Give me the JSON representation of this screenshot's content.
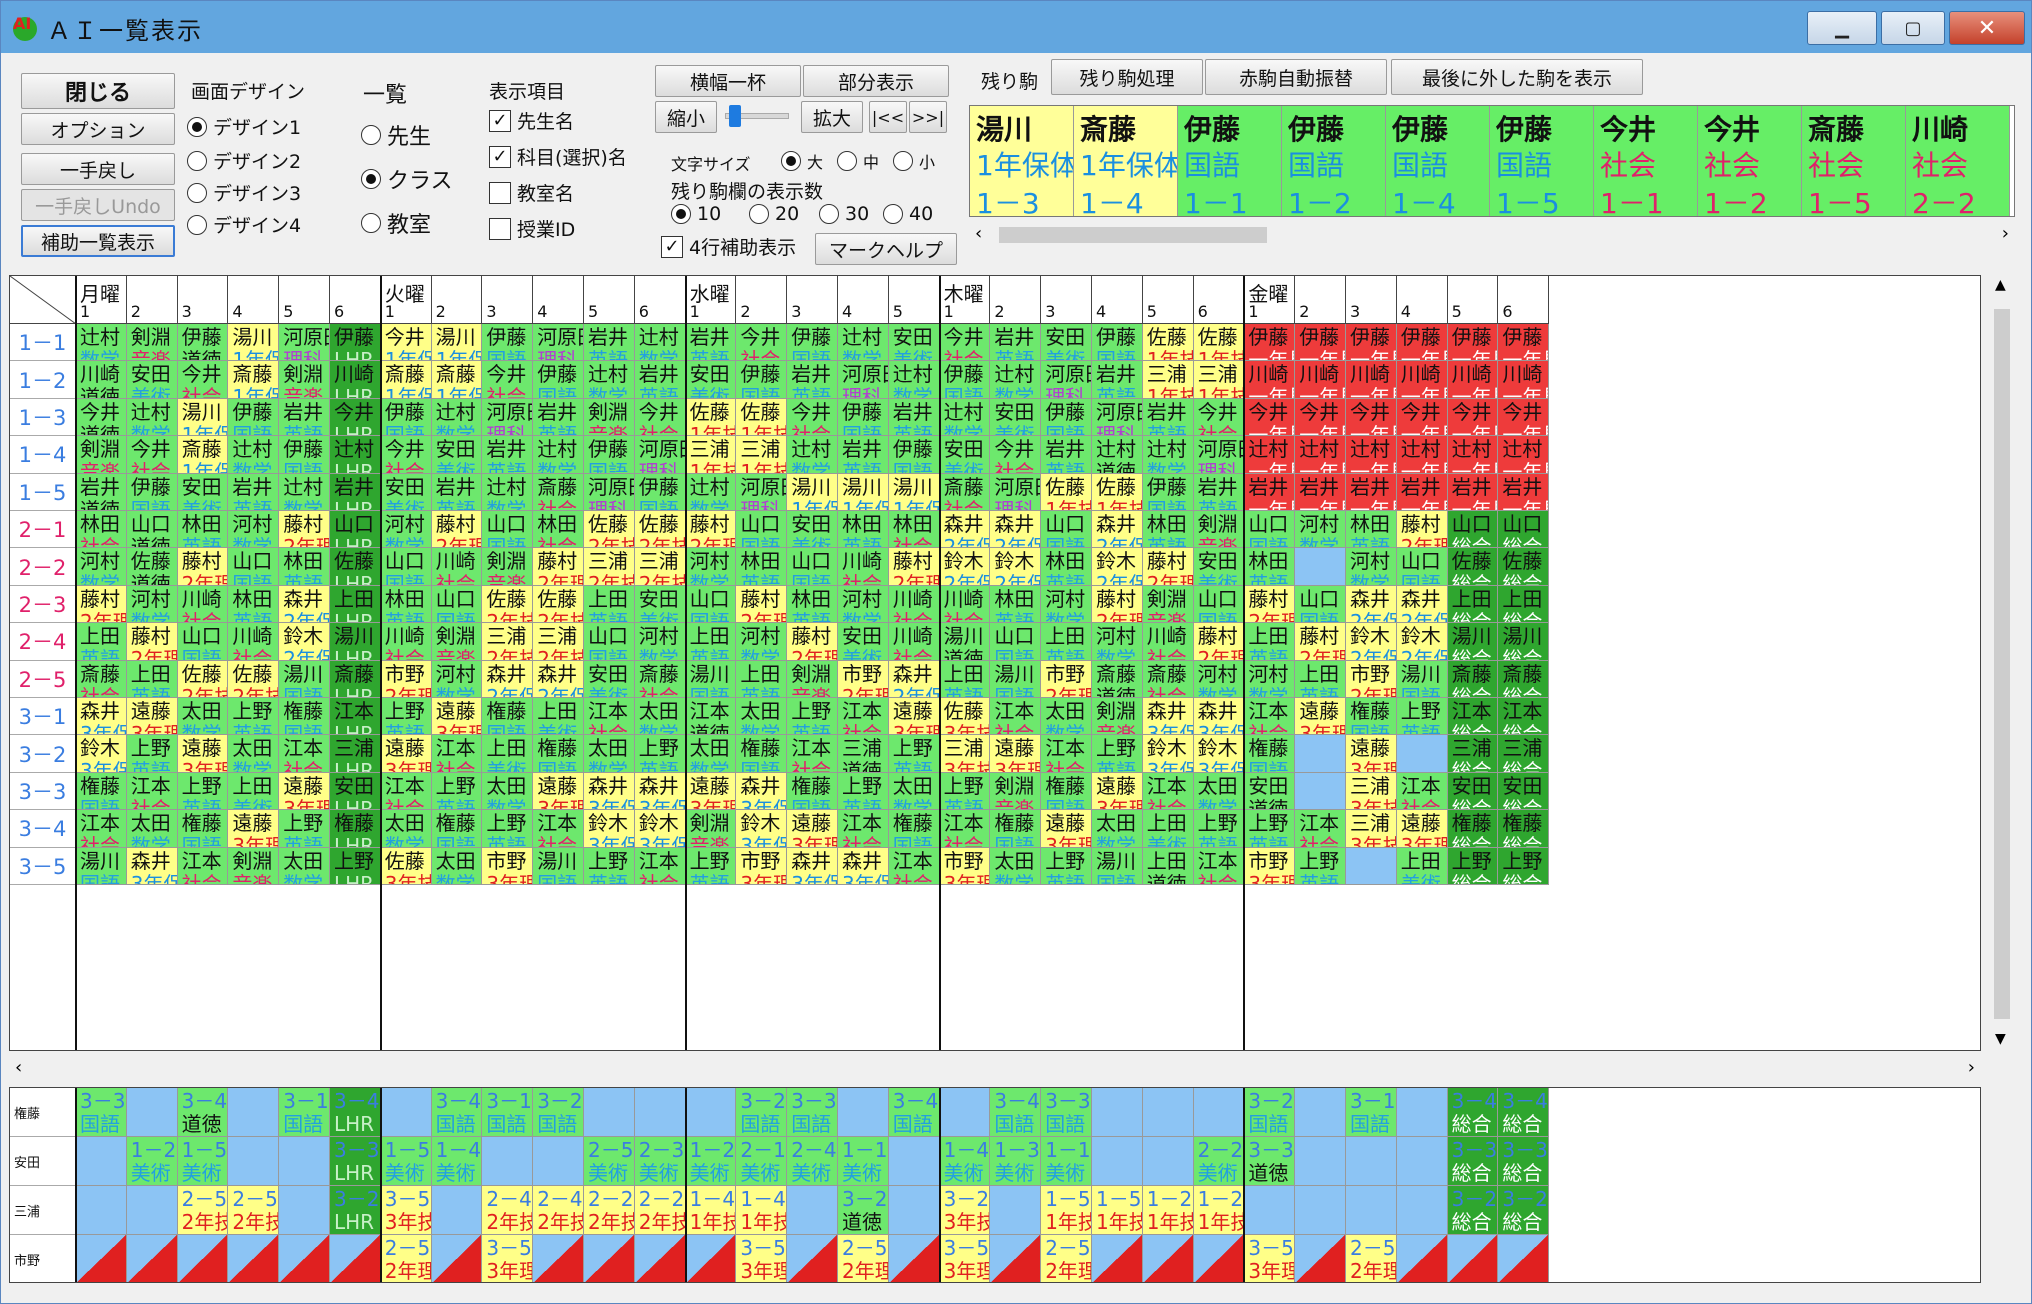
{
  "window": {
    "title": "ＡＩ一覧表示"
  },
  "controls": {
    "close": "閉じる",
    "option": "オプション",
    "undo": "一手戻し",
    "redo": "一手戻しUndo",
    "aux": "補助一覧表示",
    "design_title": "画面デザイン",
    "design_options": [
      "デザイン1",
      "デザイン2",
      "デザイン3",
      "デザイン4"
    ],
    "list_title": "一覧",
    "list_options": [
      "先生",
      "クラス",
      "教室"
    ],
    "items_title": "表示項目",
    "items": [
      "先生名",
      "科目(選択)名",
      "教室名",
      "授業ID"
    ],
    "full_width": "横幅一杯",
    "partial": "部分表示",
    "shrink": "縮小",
    "expand": "拡大",
    "nav_prev": "|<<",
    "nav_next": ">>|",
    "font_size_label": "文字サイズ",
    "font_sizes": [
      "大",
      "中",
      "小"
    ],
    "remain_count_label": "残り駒欄の表示数",
    "remain_counts": [
      "10",
      "20",
      "30",
      "40"
    ],
    "four_row": "4行補助表示",
    "mark_help": "マークヘルプ",
    "remain_label": "残り駒",
    "remain_process": "残り駒処理",
    "red_auto": "赤駒自動振替",
    "last_removed": "最後に外した駒を表示"
  },
  "remain_pieces": [
    {
      "t": "湯川",
      "s": "1年保体2",
      "c": "1－3",
      "bg": "#ffff99",
      "sc": "#1a8fe0"
    },
    {
      "t": "斎藤",
      "s": "1年保体2",
      "c": "1－4",
      "bg": "#ffff99",
      "sc": "#1a8fe0"
    },
    {
      "t": "伊藤",
      "s": "国語",
      "c": "1－1",
      "bg": "#66ee66",
      "sc": "#1a8fe0"
    },
    {
      "t": "伊藤",
      "s": "国語",
      "c": "1－2",
      "bg": "#66ee66",
      "sc": "#1a8fe0"
    },
    {
      "t": "伊藤",
      "s": "国語",
      "c": "1－4",
      "bg": "#66ee66",
      "sc": "#1a8fe0"
    },
    {
      "t": "伊藤",
      "s": "国語",
      "c": "1－5",
      "bg": "#66ee66",
      "sc": "#1a8fe0"
    },
    {
      "t": "今井",
      "s": "社会",
      "c": "1－1",
      "bg": "#66ee66",
      "sc": "#e0206a"
    },
    {
      "t": "今井",
      "s": "社会",
      "c": "1－2",
      "bg": "#66ee66",
      "sc": "#e0206a"
    },
    {
      "t": "斎藤",
      "s": "社会",
      "c": "1－5",
      "bg": "#66ee66",
      "sc": "#e0206a"
    },
    {
      "t": "川崎",
      "s": "社会",
      "c": "2－2",
      "bg": "#66ee66",
      "sc": "#e0206a"
    }
  ],
  "days": [
    "月曜",
    "火曜",
    "水曜",
    "木曜",
    "金曜"
  ],
  "periods": [
    6,
    6,
    5,
    6,
    6
  ],
  "classes": [
    "1－1",
    "1－2",
    "1－3",
    "1－4",
    "1－5",
    "2－1",
    "2－2",
    "2－3",
    "2－4",
    "2－5",
    "3－1",
    "3－2",
    "3－3",
    "3－4",
    "3－5"
  ],
  "schedule": [
    [
      "辻村 数学",
      "剣淵 音楽",
      "伊藤 道徳",
      "湯川 1年保",
      "河原田 理科",
      "伊藤 LHR",
      "今井 1年保",
      "湯川 1年保",
      "伊藤 国語",
      "河原田 理科",
      "岩井 英語",
      "辻村 数学",
      "岩井 英語",
      "今井 社会",
      "伊藤 国語",
      "辻村 数学",
      "安田 美術",
      "今井 社会",
      "岩井 英語",
      "安田 美術",
      "伊藤 国語",
      "佐藤 1年技",
      "佐藤 1年技",
      "伊藤 一年見",
      "伊藤 一年見",
      "伊藤 一年見",
      "伊藤 一年見",
      "伊藤 一年見",
      "伊藤 一年見"
    ],
    [
      "川崎 道徳",
      "安田 美術",
      "今井 社会",
      "斎藤 1年保",
      "剣淵 音楽",
      "川崎 LHR",
      "斎藤 1年保",
      "斎藤 1年保",
      "今井 社会",
      "伊藤 国語",
      "辻村 数学",
      "岩井 英語",
      "安田 美術",
      "伊藤 国語",
      "岩井 英語",
      "河原田 理科",
      "辻村 数学",
      "伊藤 国語",
      "辻村 数学",
      "河原田 理科",
      "岩井 英語",
      "三浦 1年技",
      "三浦 1年技",
      "川崎 一年見",
      "川崎 一年見",
      "川崎 一年見",
      "川崎 一年見",
      "川崎 一年見",
      "川崎 一年見"
    ],
    [
      "今井 道徳",
      "辻村 数学",
      "湯川 1年保",
      "伊藤 国語",
      "岩井 英語",
      "今井 LHR",
      "伊藤 国語",
      "辻村 数学",
      "河原田 理科",
      "岩井 英語",
      "剣淵 音楽",
      "今井 社会",
      "佐藤 1年技",
      "佐藤 1年技",
      "今井 社会",
      "伊藤 国語",
      "岩井 英語",
      "辻村 数学",
      "安田 美術",
      "伊藤 国語",
      "河原田 理科",
      "岩井 英語",
      "今井 社会",
      "今井 一年見",
      "今井 一年見",
      "今井 一年見",
      "今井 一年見",
      "今井 一年見",
      "今井 一年見"
    ],
    [
      "剣淵 音楽",
      "今井 社会",
      "斎藤 1年保",
      "辻村 数学",
      "伊藤 国語",
      "辻村 LHR",
      "今井 社会",
      "安田 美術",
      "岩井 英語",
      "辻村 数学",
      "伊藤 国語",
      "河原田 理科",
      "三浦 1年技",
      "三浦 1年技",
      "辻村 数学",
      "岩井 英語",
      "伊藤 国語",
      "安田 美術",
      "今井 社会",
      "岩井 英語",
      "辻村 道徳",
      "辻村 数学",
      "河原田 理科",
      "辻村 一年見",
      "辻村 一年見",
      "辻村 一年見",
      "辻村 一年見",
      "辻村 一年見",
      "辻村 一年見"
    ],
    [
      "岩井 道徳",
      "伊藤 国語",
      "安田 美術",
      "岩井 英語",
      "辻村 数学",
      "岩井 LHR",
      "安田 美術",
      "岩井 英語",
      "辻村 数学",
      "斎藤 社会",
      "河原田 理科",
      "伊藤 国語",
      "辻村 数学",
      "河原田 理科",
      "湯川 1年保",
      "湯川 1年保",
      "湯川 1年保",
      "斎藤 社会",
      "河原田 理科",
      "佐藤 1年技",
      "佐藤 1年技",
      "伊藤 国語",
      "岩井 英語",
      "岩井 一年見",
      "岩井 一年見",
      "岩井 一年見",
      "岩井 一年見",
      "岩井 一年見",
      "岩井 一年見"
    ],
    [
      "林田 社会",
      "山口 道徳",
      "林田 英語",
      "河村 数学",
      "藤村 2年理",
      "山口 LHR",
      "河村 数学",
      "藤村 2年理",
      "山口 国語",
      "林田 社会",
      "佐藤 2年技",
      "佐藤 2年技",
      "藤村 2年理",
      "山口 国語",
      "安田 美術",
      "林田 英語",
      "林田 社会",
      "森井 2年保",
      "森井 2年保",
      "山口 国語",
      "森井 2年保",
      "林田 英語",
      "剣淵 音楽",
      "山口 国語",
      "河村 数学",
      "林田 英語",
      "藤村 2年理",
      "山口 総合",
      "山口 総合"
    ],
    [
      "河村 数学",
      "佐藤 道徳",
      "藤村 2年理",
      "山口 国語",
      "林田 英語",
      "佐藤 LHR",
      "山口 国語",
      "川崎 社会",
      "剣淵 音楽",
      "藤村 2年理",
      "三浦 2年技",
      "三浦 2年技",
      "河村 数学",
      "林田 英語",
      "山口 国語",
      "川崎 社会",
      "藤村 2年理",
      "鈴木 2年保",
      "鈴木 2年保",
      "林田 英語",
      "鈴木 2年保",
      "藤村 2年理",
      "安田 美術",
      "林田 英語",
      "",
      "河村 数学",
      "山口 国語",
      "佐藤 総合",
      "佐藤 総合"
    ],
    [
      "藤村 2年理",
      "河村 数学",
      "川崎 社会",
      "林田 英語",
      "森井 2年保",
      "上田 LHR",
      "林田 英語",
      "山口 国語",
      "佐藤 2年技",
      "佐藤 2年技",
      "上田 英語",
      "安田 美術",
      "山口 国語",
      "藤村 2年理",
      "林田 英語",
      "河村 数学",
      "川崎 社会",
      "川崎 社会",
      "林田 英語",
      "河村 数学",
      "藤村 2年理",
      "剣淵 音楽",
      "山口 国語",
      "藤村 2年理",
      "山口 国語",
      "森井 2年保",
      "森井 2年保",
      "上田 総合",
      "上田 総合"
    ],
    [
      "上田 英語",
      "藤村 2年理",
      "山口 国語",
      "川崎 社会",
      "鈴木 2年保",
      "湯川 LHR",
      "川崎 社会",
      "剣淵 音楽",
      "三浦 2年技",
      "三浦 2年技",
      "山口 国語",
      "河村 数学",
      "上田 英語",
      "河村 数学",
      "藤村 2年理",
      "安田 美術",
      "川崎 社会",
      "湯川 道徳",
      "山口 国語",
      "上田 英語",
      "河村 数学",
      "川崎 社会",
      "藤村 2年理",
      "上田 英語",
      "藤村 2年理",
      "鈴木 2年保",
      "鈴木 2年保",
      "湯川 総合",
      "湯川 総合"
    ],
    [
      "斎藤 社会",
      "上田 英語",
      "佐藤 2年技",
      "佐藤 2年技",
      "湯川 国語",
      "斎藤 LHR",
      "市野 2年理",
      "河村 数学",
      "森井 2年保",
      "森井 2年保",
      "安田 美術",
      "斎藤 社会",
      "湯川 国語",
      "上田 英語",
      "剣淵 音楽",
      "市野 2年理",
      "森井 2年保",
      "上田 英語",
      "湯川 国語",
      "市野 2年理",
      "斎藤 道徳",
      "斎藤 社会",
      "河村 数学",
      "河村 数学",
      "上田 英語",
      "市野 2年理",
      "湯川 国語",
      "斎藤 総合",
      "斎藤 総合"
    ],
    [
      "森井 3年保",
      "遠藤 3年理",
      "太田 数学",
      "上野 英語",
      "権藤 国語",
      "江本 LHR",
      "上野 英語",
      "遠藤 3年理",
      "権藤 国語",
      "上田 美術",
      "江本 社会",
      "太田 数学",
      "江本 道徳",
      "太田 数学",
      "上野 英語",
      "江本 社会",
      "遠藤 3年理",
      "佐藤 3年技",
      "江本 社会",
      "太田 数学",
      "剣淵 音楽",
      "森井 3年保",
      "森井 3年保",
      "江本 社会",
      "遠藤 3年理",
      "権藤 国語",
      "上野 英語",
      "江本 総合",
      "江本 総合"
    ],
    [
      "鈴木 3年保",
      "上野 英語",
      "遠藤 3年理",
      "太田 数学",
      "江本 社会",
      "三浦 LHR",
      "遠藤 3年理",
      "江本 社会",
      "上田 美術",
      "権藤 国語",
      "太田 数学",
      "上野 英語",
      "太田 数学",
      "権藤 国語",
      "江本 社会",
      "三浦 道徳",
      "上野 英語",
      "三浦 3年技",
      "遠藤 3年理",
      "江本 社会",
      "上野 英語",
      "鈴木 3年保",
      "鈴木 3年保",
      "権藤 国語",
      "",
      "遠藤 3年理",
      "",
      "三浦 総合",
      "三浦 総合"
    ],
    [
      "権藤 国語",
      "江本 社会",
      "上野 英語",
      "上田 美術",
      "遠藤 3年理",
      "安田 LHR",
      "江本 社会",
      "上野 英語",
      "太田 数学",
      "遠藤 3年理",
      "森井 3年保",
      "森井 3年保",
      "遠藤 3年理",
      "森井 3年保",
      "権藤 国語",
      "上野 英語",
      "太田 数学",
      "上野 英語",
      "剣淵 音楽",
      "権藤 国語",
      "遠藤 3年理",
      "江本 社会",
      "太田 数学",
      "安田 道徳",
      "",
      "三浦 3年技",
      "江本 社会",
      "安田 総合",
      "安田 総合"
    ],
    [
      "江本 社会",
      "太田 数学",
      "権藤 国語",
      "遠藤 3年理",
      "上野 英語",
      "権藤 LHR",
      "太田 数学",
      "権藤 国語",
      "上野 英語",
      "江本 社会",
      "鈴木 3年保",
      "鈴木 3年保",
      "剣淵 音楽",
      "鈴木 3年保",
      "遠藤 3年理",
      "江本 社会",
      "権藤 国語",
      "江本 社会",
      "権藤 国語",
      "遠藤 3年理",
      "太田 数学",
      "上田 美術",
      "上野 英語",
      "上野 英語",
      "江本 社会",
      "三浦 3年技",
      "遠藤 3年理",
      "権藤 総合",
      "権藤 総合"
    ],
    [
      "湯川 国語",
      "森井 3年保",
      "江本 社会",
      "剣淵 音楽",
      "太田 数学",
      "上野 LHR",
      "佐藤 3年技",
      "太田 数学",
      "市野 3年理",
      "湯川 国語",
      "上野 英語",
      "江本 社会",
      "上野 英語",
      "市野 3年理",
      "森井 3年保",
      "森井 3年保",
      "江本 社会",
      "市野 3年理",
      "太田 数学",
      "上野 英語",
      "湯川 国語",
      "上田 道徳",
      "江本 社会",
      "市野 3年理",
      "上野 英語",
      "",
      "上田 美術",
      "上野 総合",
      "上野 総合"
    ]
  ],
  "teachers": [
    "権藤",
    "安田",
    "三浦",
    "市野"
  ],
  "teacher_schedule": [
    [
      "3－3 国語",
      "",
      "3－4 道徳",
      "",
      "3－1 国語",
      "3－4 LHR",
      "",
      "3－4 国語",
      "3－1 国語",
      "3－2 国語",
      "",
      "",
      "",
      "3－2 国語",
      "3－3 国語",
      "",
      "3－4 国語",
      "",
      "3－4 国語",
      "3－3 国語",
      "",
      "",
      "",
      "3－2 国語",
      "",
      "3－1 国語",
      "",
      "3－4 総合",
      "3－4 総合"
    ],
    [
      "",
      "1－2 美術",
      "1－5 美術",
      "",
      "",
      "3－3 LHR",
      "1－5 美術",
      "1－4 美術",
      "",
      "",
      "2－5 美術",
      "2－3 美術",
      "1－2 美術",
      "2－1 美術",
      "2－4 美術",
      "1－1 美術",
      "",
      "1－4 美術",
      "1－3 美術",
      "1－1 美術",
      "",
      "",
      "2－2 美術",
      "3－3 道徳",
      "",
      "",
      "",
      "3－3 総合",
      "3－3 総合"
    ],
    [
      "",
      "",
      "2－5 2年技",
      "2－5 2年技",
      "",
      "3－2 LHR",
      "3－5 3年技",
      "",
      "2－4 2年技",
      "2－4 2年技",
      "2－2 2年技",
      "2－2 2年技",
      "1－4 1年技",
      "1－4 1年技",
      "",
      "3－2 道徳",
      "",
      "3－2 3年技",
      "",
      "1－5 1年技",
      "1－5 1年技",
      "1－2 1年技",
      "1－2 1年技",
      "",
      "",
      "",
      "",
      "3－2 総合",
      "3－2 総合"
    ],
    [
      "",
      "",
      "",
      "",
      "",
      "",
      "2－5 2年理",
      "",
      "3－5 3年理",
      "",
      "",
      "",
      "",
      "3－5 3年理",
      "",
      "2－5 2年理",
      "",
      "3－5 3年理",
      "",
      "2－5 2年理",
      "",
      "",
      "",
      "3－5 3年理",
      "",
      "2－5 2年理",
      "",
      "",
      ""
    ]
  ]
}
